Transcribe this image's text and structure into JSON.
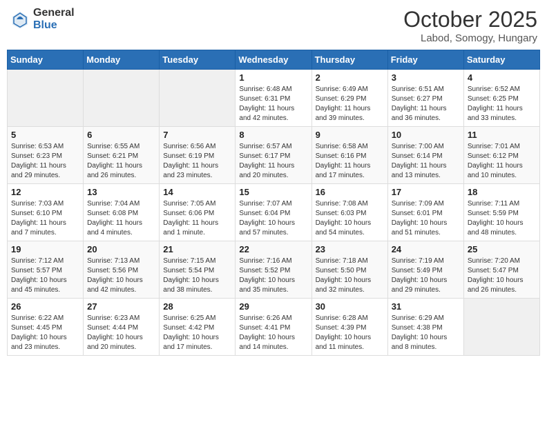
{
  "header": {
    "logo_general": "General",
    "logo_blue": "Blue",
    "month_title": "October 2025",
    "location": "Labod, Somogy, Hungary"
  },
  "weekdays": [
    "Sunday",
    "Monday",
    "Tuesday",
    "Wednesday",
    "Thursday",
    "Friday",
    "Saturday"
  ],
  "weeks": [
    [
      {
        "day": "",
        "info": ""
      },
      {
        "day": "",
        "info": ""
      },
      {
        "day": "",
        "info": ""
      },
      {
        "day": "1",
        "info": "Sunrise: 6:48 AM\nSunset: 6:31 PM\nDaylight: 11 hours and 42 minutes."
      },
      {
        "day": "2",
        "info": "Sunrise: 6:49 AM\nSunset: 6:29 PM\nDaylight: 11 hours and 39 minutes."
      },
      {
        "day": "3",
        "info": "Sunrise: 6:51 AM\nSunset: 6:27 PM\nDaylight: 11 hours and 36 minutes."
      },
      {
        "day": "4",
        "info": "Sunrise: 6:52 AM\nSunset: 6:25 PM\nDaylight: 11 hours and 33 minutes."
      }
    ],
    [
      {
        "day": "5",
        "info": "Sunrise: 6:53 AM\nSunset: 6:23 PM\nDaylight: 11 hours and 29 minutes."
      },
      {
        "day": "6",
        "info": "Sunrise: 6:55 AM\nSunset: 6:21 PM\nDaylight: 11 hours and 26 minutes."
      },
      {
        "day": "7",
        "info": "Sunrise: 6:56 AM\nSunset: 6:19 PM\nDaylight: 11 hours and 23 minutes."
      },
      {
        "day": "8",
        "info": "Sunrise: 6:57 AM\nSunset: 6:17 PM\nDaylight: 11 hours and 20 minutes."
      },
      {
        "day": "9",
        "info": "Sunrise: 6:58 AM\nSunset: 6:16 PM\nDaylight: 11 hours and 17 minutes."
      },
      {
        "day": "10",
        "info": "Sunrise: 7:00 AM\nSunset: 6:14 PM\nDaylight: 11 hours and 13 minutes."
      },
      {
        "day": "11",
        "info": "Sunrise: 7:01 AM\nSunset: 6:12 PM\nDaylight: 11 hours and 10 minutes."
      }
    ],
    [
      {
        "day": "12",
        "info": "Sunrise: 7:03 AM\nSunset: 6:10 PM\nDaylight: 11 hours and 7 minutes."
      },
      {
        "day": "13",
        "info": "Sunrise: 7:04 AM\nSunset: 6:08 PM\nDaylight: 11 hours and 4 minutes."
      },
      {
        "day": "14",
        "info": "Sunrise: 7:05 AM\nSunset: 6:06 PM\nDaylight: 11 hours and 1 minute."
      },
      {
        "day": "15",
        "info": "Sunrise: 7:07 AM\nSunset: 6:04 PM\nDaylight: 10 hours and 57 minutes."
      },
      {
        "day": "16",
        "info": "Sunrise: 7:08 AM\nSunset: 6:03 PM\nDaylight: 10 hours and 54 minutes."
      },
      {
        "day": "17",
        "info": "Sunrise: 7:09 AM\nSunset: 6:01 PM\nDaylight: 10 hours and 51 minutes."
      },
      {
        "day": "18",
        "info": "Sunrise: 7:11 AM\nSunset: 5:59 PM\nDaylight: 10 hours and 48 minutes."
      }
    ],
    [
      {
        "day": "19",
        "info": "Sunrise: 7:12 AM\nSunset: 5:57 PM\nDaylight: 10 hours and 45 minutes."
      },
      {
        "day": "20",
        "info": "Sunrise: 7:13 AM\nSunset: 5:56 PM\nDaylight: 10 hours and 42 minutes."
      },
      {
        "day": "21",
        "info": "Sunrise: 7:15 AM\nSunset: 5:54 PM\nDaylight: 10 hours and 38 minutes."
      },
      {
        "day": "22",
        "info": "Sunrise: 7:16 AM\nSunset: 5:52 PM\nDaylight: 10 hours and 35 minutes."
      },
      {
        "day": "23",
        "info": "Sunrise: 7:18 AM\nSunset: 5:50 PM\nDaylight: 10 hours and 32 minutes."
      },
      {
        "day": "24",
        "info": "Sunrise: 7:19 AM\nSunset: 5:49 PM\nDaylight: 10 hours and 29 minutes."
      },
      {
        "day": "25",
        "info": "Sunrise: 7:20 AM\nSunset: 5:47 PM\nDaylight: 10 hours and 26 minutes."
      }
    ],
    [
      {
        "day": "26",
        "info": "Sunrise: 6:22 AM\nSunset: 4:45 PM\nDaylight: 10 hours and 23 minutes."
      },
      {
        "day": "27",
        "info": "Sunrise: 6:23 AM\nSunset: 4:44 PM\nDaylight: 10 hours and 20 minutes."
      },
      {
        "day": "28",
        "info": "Sunrise: 6:25 AM\nSunset: 4:42 PM\nDaylight: 10 hours and 17 minutes."
      },
      {
        "day": "29",
        "info": "Sunrise: 6:26 AM\nSunset: 4:41 PM\nDaylight: 10 hours and 14 minutes."
      },
      {
        "day": "30",
        "info": "Sunrise: 6:28 AM\nSunset: 4:39 PM\nDaylight: 10 hours and 11 minutes."
      },
      {
        "day": "31",
        "info": "Sunrise: 6:29 AM\nSunset: 4:38 PM\nDaylight: 10 hours and 8 minutes."
      },
      {
        "day": "",
        "info": ""
      }
    ]
  ]
}
